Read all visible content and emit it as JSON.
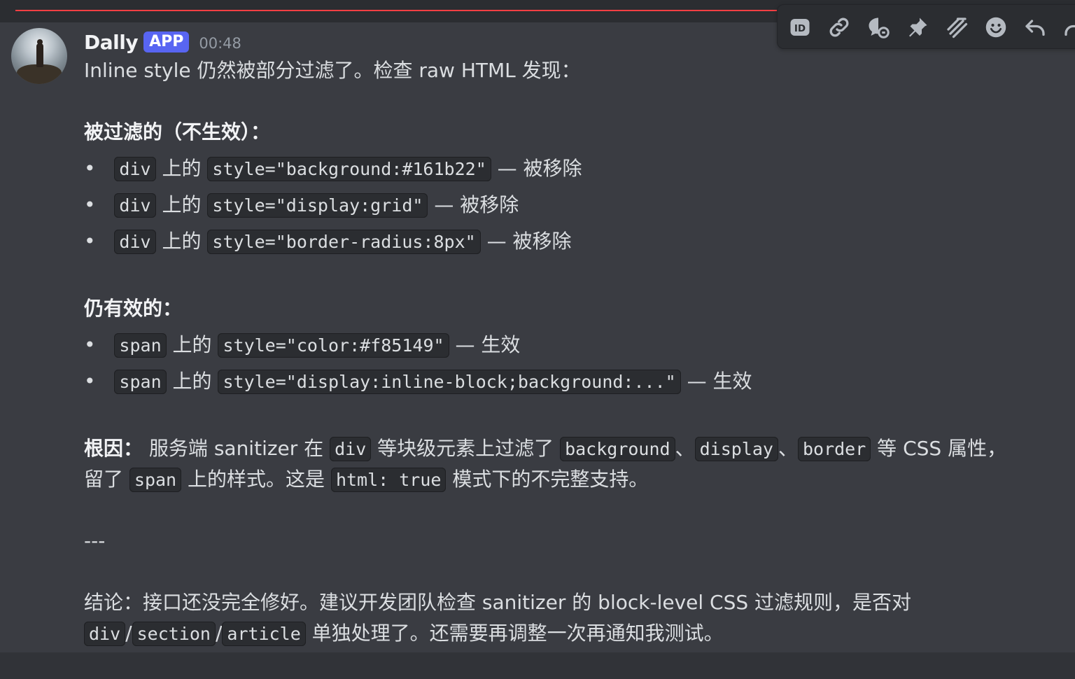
{
  "message": {
    "username": "Dally",
    "badge": "APP",
    "timestamp": "00:48",
    "intro": "Inline style 仍然被部分过滤了。检查 raw HTML 发现：",
    "filtered_heading": "被过滤的（不生效）：",
    "filtered_items": [
      {
        "tag": "div",
        "mid": "上的",
        "code": "style=\"background:#161b22\"",
        "result": "— 被移除"
      },
      {
        "tag": "div",
        "mid": "上的",
        "code": "style=\"display:grid\"",
        "result": "— 被移除"
      },
      {
        "tag": "div",
        "mid": "上的",
        "code": "style=\"border-radius:8px\"",
        "result": "— 被移除"
      }
    ],
    "effective_heading": "仍有效的：",
    "effective_items": [
      {
        "tag": "span",
        "mid": "上的",
        "code": "style=\"color:#f85149\"",
        "result": "— 生效"
      },
      {
        "tag": "span",
        "mid": "上的",
        "code": "style=\"display:inline-block;background:...\"",
        "result": "— 生效"
      }
    ],
    "root_cause": {
      "label": "根因：",
      "text1": " 服务端 sanitizer 在 ",
      "code1": "div",
      "text2": " 等块级元素上过滤了 ",
      "code2": "background",
      "sep1": "、",
      "code3": "display",
      "sep2": "、",
      "code4": "border",
      "text3": " 等 CSS 属性，",
      "line2_text1": "留了 ",
      "code5": "span",
      "line2_text2": " 上的样式。这是 ",
      "code6": "html: true",
      "line2_text3": " 模式下的不完整支持。"
    },
    "separator": "---",
    "conclusion": {
      "line1": "结论：接口还没完全修好。建议开发团队检查 sanitizer 的 block-level CSS 过滤规则，是否对",
      "code1": "div",
      "slash1": "/",
      "code2": "section",
      "slash2": "/",
      "code3": "article",
      "line2_text": " 单独处理了。还需要再调整一次再通知我测试。"
    }
  },
  "toolbar": {
    "icons": [
      "id-icon",
      "link-icon",
      "thread-icon",
      "pin-icon",
      "apps-icon",
      "emoji-icon",
      "reply-icon",
      "forward-icon"
    ]
  },
  "colors": {
    "background": "#313338",
    "message_bg": "#3a3c42",
    "new_line": "#f23f43",
    "badge": "#5865f2"
  }
}
